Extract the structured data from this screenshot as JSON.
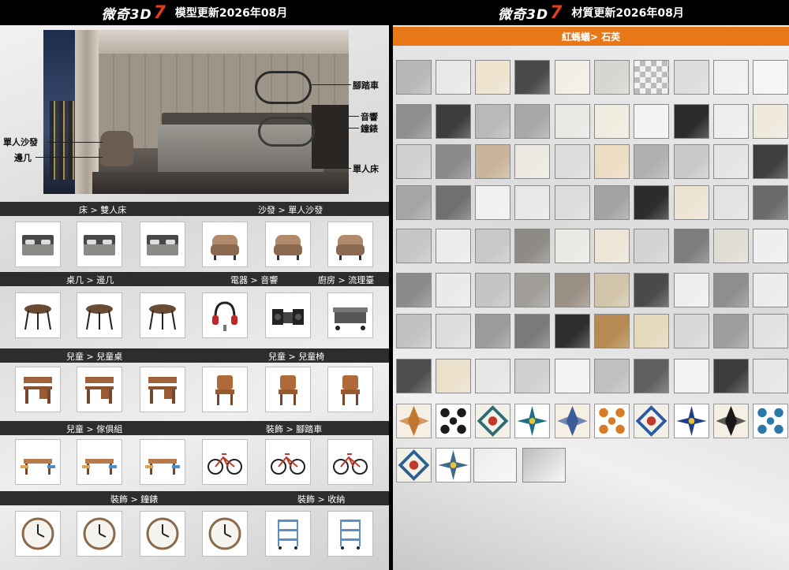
{
  "left": {
    "header": {
      "brand": "微奇3D",
      "brand_seven": "7",
      "title": "模型更新2026年08月"
    },
    "room_labels": {
      "bicycle": "腳踏車",
      "speaker": "音響",
      "clock": "鐘錶",
      "single_sofa": "單人沙發",
      "side_table": "邊几",
      "single_bed": "單人床"
    },
    "sections": [
      {
        "labels": [
          "床 > 雙人床",
          "沙發 > 單人沙發"
        ]
      },
      {
        "labels": [
          "桌几 > 邊几",
          "電器 > 音響",
          "廚房 > 流理臺"
        ]
      },
      {
        "labels": [
          "兒童 > 兒童桌",
          "兒童 > 兒童椅"
        ]
      },
      {
        "labels": [
          "兒童 > 傢俱組",
          "裝飾 > 腳踏車"
        ]
      },
      {
        "labels": [
          "裝飾 > 鐘錶",
          "裝飾 > 收納"
        ]
      }
    ],
    "thumb_icons": [
      [
        "bed-icon",
        "bed-icon",
        "bed-icon",
        "armchair-icon",
        "armchair-icon",
        "armchair-icon"
      ],
      [
        "side-table-icon",
        "side-table-icon",
        "side-table-icon",
        "headphones-icon",
        "speaker-icon",
        "kitchen-counter-icon"
      ],
      [
        "kids-desk-icon",
        "kids-desk-icon",
        "kids-desk-icon",
        "kids-chair-icon",
        "kids-chair-icon",
        "kids-chair-icon"
      ],
      [
        "furniture-set-icon",
        "furniture-set-icon",
        "furniture-set-icon",
        "bicycle-icon",
        "bicycle-icon",
        "bicycle-icon"
      ],
      [
        "clock-icon",
        "clock-icon",
        "clock-icon",
        "clock-icon",
        "storage-cart-icon",
        "storage-cart-icon"
      ]
    ]
  },
  "right": {
    "header": {
      "brand": "微奇3D",
      "brand_seven": "7",
      "title": "材質更新2026年08月"
    },
    "category_bar": "紅螞蟻> 石英",
    "accent_color": "#e87817",
    "tile_rows": [
      [
        "#b8b8b8",
        "#e8e8e8",
        "#ede3cf",
        "#4a4a4a",
        "#f3efe6",
        "#d8d6d3",
        "pattern",
        "#dcdcdc",
        "#f0f0f0",
        "#f5f5f5"
      ],
      [
        "#8f8f8f",
        "#3d3d3d",
        "#b9b9b9",
        "#a8a8a8",
        "#e9e8e5",
        "#f1ece0",
        "#f3f3f3",
        "#2b2b2b",
        "#eeeeee",
        "#efe9de"
      ],
      [
        "#cfcfcf",
        "#8a8a8a",
        "#c9b49a",
        "#ece9e2",
        "#dcdcdc",
        "#ecdcc3",
        "#b0b0b0",
        "#c9c9c9",
        "#e5e5e5",
        "#3e3e3e"
      ],
      [
        "#a5a5a5",
        "#707070",
        "#f0f0f0",
        "#e8e8e8",
        "#dcdcdc",
        "#a3a3a3",
        "#2c2c2c",
        "#eee4d4",
        "#e3e3e3",
        "#6a6a6a"
      ],
      [
        "#c6c6c6",
        "#ebebeb",
        "#c8c8c8",
        "#8e8a86",
        "#ebe9e4",
        "#ede5d8",
        "#d3d3d3",
        "#7d7d7d",
        "#e0ddd4",
        "#efefef"
      ],
      [
        "#8b8b8b",
        "#eaeaea",
        "#c4c4c4",
        "#a19d99",
        "#9a8f85",
        "#d1c4aa",
        "#4a4a4a",
        "#eeeeee",
        "#8e8e8e",
        "#ececec"
      ],
      [
        "#c2c2c2",
        "#dddddd",
        "#9b9b9b",
        "#7a7a7a",
        "#2e2e2e",
        "#b68a52",
        "#e5d9bd",
        "#d8d8d8",
        "#9d9d9d",
        "#e2e2e2"
      ],
      [
        "#4d4d4d",
        "#eae0cb",
        "#e6e6e6",
        "#cfcfcf",
        "#f2f2f2",
        "#c0c0c0",
        "#5f5f5f",
        "#f2f2f2",
        "#3d3d3d",
        "#e6e6e6"
      ]
    ],
    "pattern_tiles": [
      [
        "#c2762e",
        "#1b1b1b",
        "#2d6b72",
        "#1e6f86",
        "#3b5d9a",
        "#d67b26",
        "#2a5aa6",
        "#1d3f8a",
        "#1a1a1a",
        "#2c78a8"
      ],
      [
        "#2b5f8f",
        "#3b6a8a"
      ]
    ],
    "wide_tiles": [
      "#ececec",
      "#bdbdbd"
    ]
  }
}
